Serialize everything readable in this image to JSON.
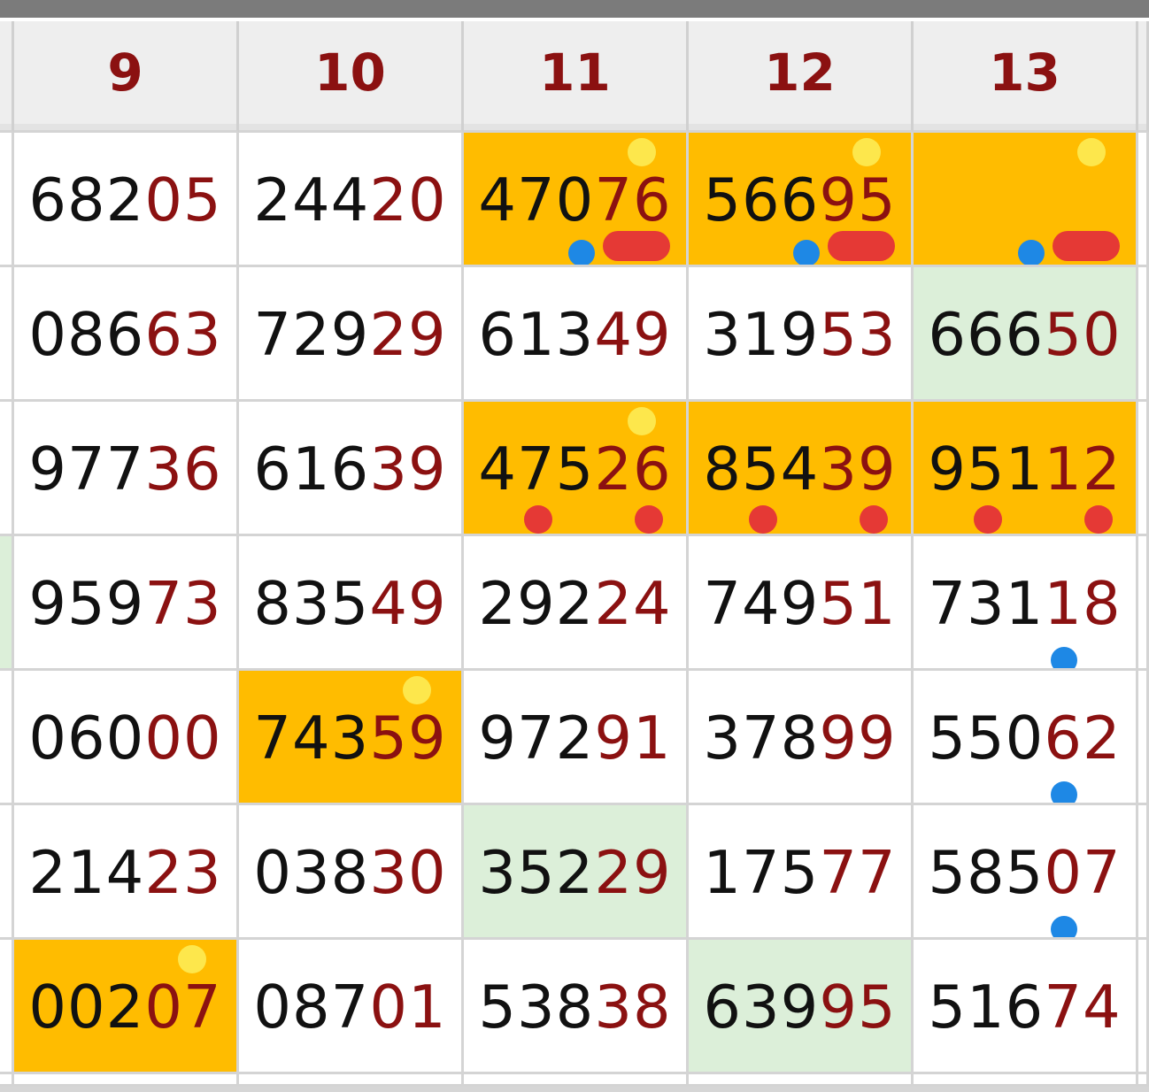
{
  "table": {
    "headers": [
      "9",
      "10",
      "11",
      "12",
      "13"
    ],
    "rows": [
      [
        {
          "head": "682",
          "tail": "05",
          "fill": "white"
        },
        {
          "head": "244",
          "tail": "20",
          "fill": "white"
        },
        {
          "head": "470",
          "tail": "76",
          "fill": "orange"
        },
        {
          "head": "566",
          "tail": "95",
          "fill": "orange"
        },
        {
          "head": "",
          "tail": "",
          "fill": "orange"
        }
      ],
      [
        {
          "head": "086",
          "tail": "63",
          "fill": "white"
        },
        {
          "head": "729",
          "tail": "29",
          "fill": "white"
        },
        {
          "head": "613",
          "tail": "49",
          "fill": "white"
        },
        {
          "head": "319",
          "tail": "53",
          "fill": "white"
        },
        {
          "head": "666",
          "tail": "50",
          "fill": "green"
        }
      ],
      [
        {
          "head": "977",
          "tail": "36",
          "fill": "white"
        },
        {
          "head": "616",
          "tail": "39",
          "fill": "white"
        },
        {
          "head": "475",
          "tail": "26",
          "fill": "orange"
        },
        {
          "head": "854",
          "tail": "39",
          "fill": "orange"
        },
        {
          "head": "951",
          "tail": "12",
          "fill": "orange"
        }
      ],
      [
        {
          "head": "959",
          "tail": "73",
          "fill": "white"
        },
        {
          "head": "835",
          "tail": "49",
          "fill": "white"
        },
        {
          "head": "292",
          "tail": "24",
          "fill": "white"
        },
        {
          "head": "749",
          "tail": "51",
          "fill": "white"
        },
        {
          "head": "731",
          "tail": "18",
          "fill": "white"
        }
      ],
      [
        {
          "head": "060",
          "tail": "00",
          "fill": "white"
        },
        {
          "head": "743",
          "tail": "59",
          "fill": "orange"
        },
        {
          "head": "972",
          "tail": "91",
          "fill": "white"
        },
        {
          "head": "378",
          "tail": "99",
          "fill": "white"
        },
        {
          "head": "550",
          "tail": "62",
          "fill": "white"
        }
      ],
      [
        {
          "head": "214",
          "tail": "23",
          "fill": "white"
        },
        {
          "head": "038",
          "tail": "30",
          "fill": "white"
        },
        {
          "head": "352",
          "tail": "29",
          "fill": "green"
        },
        {
          "head": "175",
          "tail": "77",
          "fill": "white"
        },
        {
          "head": "585",
          "tail": "07",
          "fill": "white"
        }
      ],
      [
        {
          "head": "002",
          "tail": "07",
          "fill": "orange"
        },
        {
          "head": "087",
          "tail": "01",
          "fill": "white"
        },
        {
          "head": "538",
          "tail": "38",
          "fill": "white"
        },
        {
          "head": "639",
          "tail": "95",
          "fill": "green"
        },
        {
          "head": "516",
          "tail": "74",
          "fill": "white"
        }
      ]
    ],
    "left_edge_fill": [
      "white",
      "white",
      "white",
      "green",
      "white",
      "white",
      "white"
    ],
    "colors": {
      "header_text": "#8b1111",
      "tail_text": "#8b1111",
      "highlight_orange": "#ffbc00",
      "highlight_green": "#dcefd9",
      "mark_yellow": "#fde74c",
      "mark_blue": "#1e88e5",
      "mark_red": "#e53935"
    },
    "marks": [
      {
        "row": 0,
        "col": 2,
        "kind": "yellow-dot",
        "where": "top-right"
      },
      {
        "row": 0,
        "col": 2,
        "kind": "blue-dot",
        "where": "bottom-center"
      },
      {
        "row": 0,
        "col": 2,
        "kind": "red-scribble",
        "where": "bottom-right"
      },
      {
        "row": 0,
        "col": 3,
        "kind": "yellow-dot",
        "where": "top-right"
      },
      {
        "row": 0,
        "col": 3,
        "kind": "blue-dot",
        "where": "bottom-center"
      },
      {
        "row": 0,
        "col": 3,
        "kind": "red-scribble",
        "where": "bottom-right"
      },
      {
        "row": 0,
        "col": 4,
        "kind": "yellow-dot",
        "where": "top-right"
      },
      {
        "row": 0,
        "col": 4,
        "kind": "blue-dot",
        "where": "bottom-center"
      },
      {
        "row": 0,
        "col": 4,
        "kind": "red-scribble",
        "where": "bottom-right"
      },
      {
        "row": 2,
        "col": 2,
        "kind": "yellow-dot",
        "where": "top-right"
      },
      {
        "row": 2,
        "col": 2,
        "kind": "red-dot",
        "where": "bottom-left"
      },
      {
        "row": 2,
        "col": 2,
        "kind": "red-dot",
        "where": "bottom-right"
      },
      {
        "row": 2,
        "col": 3,
        "kind": "red-dot",
        "where": "bottom-left"
      },
      {
        "row": 2,
        "col": 3,
        "kind": "red-dot",
        "where": "bottom-right"
      },
      {
        "row": 2,
        "col": 4,
        "kind": "red-dot",
        "where": "bottom-left"
      },
      {
        "row": 2,
        "col": 4,
        "kind": "red-dot",
        "where": "bottom-right"
      },
      {
        "row": 3,
        "col": 4,
        "kind": "blue-dot",
        "where": "bottom-tail"
      },
      {
        "row": 4,
        "col": 1,
        "kind": "yellow-dot",
        "where": "top-right"
      },
      {
        "row": 4,
        "col": 4,
        "kind": "blue-dot",
        "where": "bottom-tail"
      },
      {
        "row": 5,
        "col": 4,
        "kind": "blue-dot",
        "where": "bottom-tail"
      },
      {
        "row": 6,
        "col": 0,
        "kind": "yellow-dot",
        "where": "top-right"
      }
    ]
  }
}
